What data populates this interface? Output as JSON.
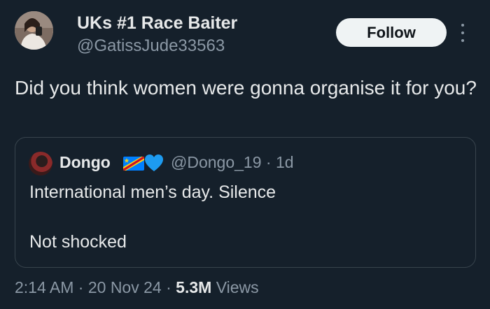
{
  "author": {
    "display_name": "UKs #1 Race Baiter",
    "handle": "@GatissJude33563"
  },
  "follow_label": "Follow",
  "tweet_text": "Did you think women were gonna organise it for you?",
  "quoted_tweet": {
    "display_name": "Dongo",
    "handle": "@Dongo_19",
    "separator": "·",
    "age": "1d",
    "text_line1": "International men’s day. Silence",
    "text_line2": "Not shocked"
  },
  "footer": {
    "time": "2:14 AM",
    "sep1": "·",
    "date": "20 Nov 24",
    "sep2": "·",
    "views_count": "5.3M",
    "views_label": "Views"
  },
  "icons": {
    "more": "more-vertical-icon",
    "flag": "dr-congo-flag-icon",
    "heart": "blue-heart-icon"
  },
  "colors": {
    "background": "#15202b",
    "text": "#e7e9ea",
    "secondary_text": "#8b98a5",
    "border": "#38444d",
    "follow_bg": "#eff3f4",
    "heart": "#1d9bf0"
  }
}
